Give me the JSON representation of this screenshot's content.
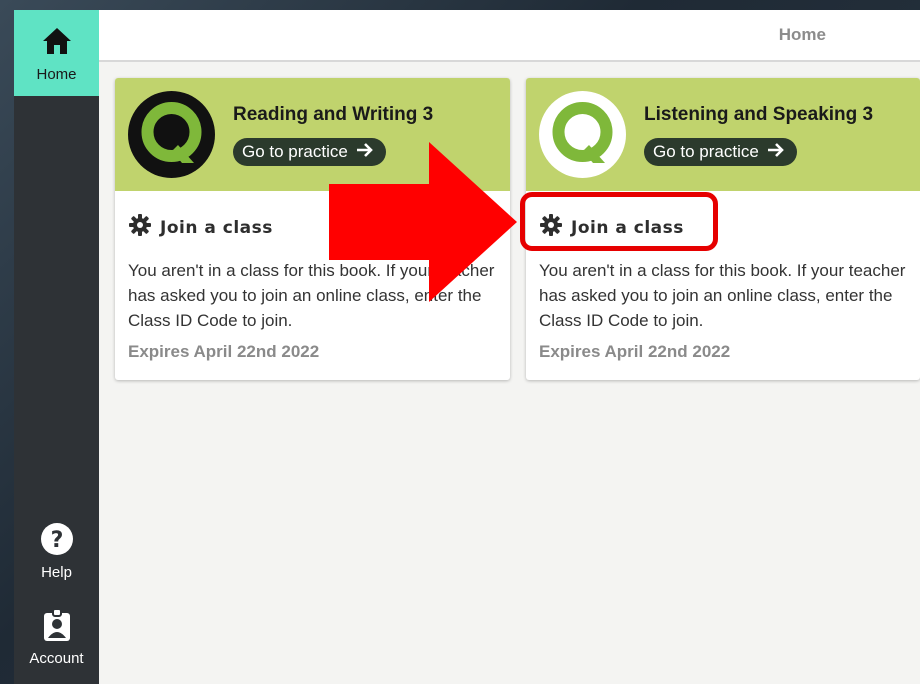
{
  "sidebar": {
    "home": {
      "label": "Home",
      "icon": "home-icon"
    },
    "help": {
      "label": "Help",
      "icon": "help-icon"
    },
    "account": {
      "label": "Account",
      "icon": "account-icon"
    }
  },
  "topbar": {
    "title": "Home"
  },
  "cards": [
    {
      "title": "Reading and Writing 3",
      "practice_label": "Go to practice",
      "join_label": "Join a class",
      "description": "You aren't in a class for this book. If your teacher has asked you to join an online class, enter the Class ID Code to join.",
      "expires": "Expires April 22nd 2022",
      "logo_style": "dark"
    },
    {
      "title": "Listening and Speaking 3",
      "practice_label": "Go to practice",
      "join_label": "Join a class",
      "description": "You aren't in a class for this book. If your teacher has asked you to join an online class, enter the Class ID Code to join.",
      "expires": "Expires April 22nd 2022",
      "logo_style": "light"
    }
  ],
  "colors": {
    "accent_teal": "#5fe3c4",
    "card_header": "#c0d36d",
    "annotation_red": "#e60000"
  }
}
